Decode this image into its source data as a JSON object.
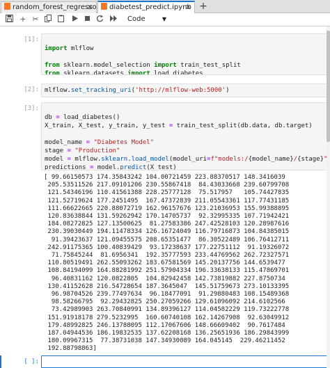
{
  "tabs": [
    {
      "label": "random_forest_regressor_s",
      "active": false
    },
    {
      "label": "diabetest_predict.ipynb",
      "active": true
    }
  ],
  "toolbar": {
    "cell_type": "Code"
  },
  "cells": [
    {
      "prompt": "[1]:",
      "lines": [
        "import mlflow",
        "",
        "from sklearn.model_selection import train_test_split",
        "from sklearn.datasets import load_diabetes"
      ]
    },
    {
      "prompt": "[2]:",
      "lines": [
        "mlflow.set_tracking_uri('http://mlflow-web:5000')"
      ]
    },
    {
      "prompt": "[3]:",
      "lines": [
        "db = load_diabetes()",
        "X_train, X_test, y_train, y_test = train_test_split(db.data, db.target)",
        "",
        "model_name = \"Diabetes Model\"",
        "stage = \"Production\"",
        "model = mlflow.sklearn.load_model(model_uri=f\"models:/{model_name}/{stage}\")",
        "predictions = model.predict(X_test)",
        "print(predictions)"
      ],
      "output": [
        "[ 99.66150573 174.35843242 104.00721459 223.88370517 148.3416039",
        " 205.53511526 217.09101206 230.55867418  84.43033668 239.60799708",
        " 121.54346196 110.41561388 228.25777128  75.517957   105.74427835",
        " 121.52719624 177.2451495  167.47372839 211.05543361 117.77431185",
        " 111.66622665 220.88072719 162.96157676 123.21036953 155.99388895",
        " 120.83638844 131.59262942 170.14705737  92.32995335 107.71942421",
        " 184.08272825 127.13500625  81.27583386 247.42528103 120.28987616",
        " 230.39030449 194.11478334 126.16724049 116.79716873 104.84385015",
        "  91.39423637 121.09455575 208.65351477  86.30522489 106.76412711",
        " 242.91175365 100.40839429  93.17238637 177.22751112  91.19326072",
        "  71.75845244  81.6956341  192.35777593 233.44769562 262.72327571",
        " 110.80519491 262.55093262 183.67581569 145.20137756 144.6539477",
        " 108.84194099 164.88281992 251.57904334 196.33638133 115.47869701",
        "  96.40831162 120.0822805  104.82942458 142.73819882 227.8750734",
        " 130.41152628 216.54728654 187.3645047  145.51759673 273.10133395",
        "  96.98704526 239.77497634  96.18477091  91.29880483 108.15489368",
        "  98.58266795  92.29432825 250.27059266 129.61096092 214.6102566",
        "  73.42989903 263.70840991 134.89396127 114.04582229 119.73222778",
        " 151.91918178 279.5232995  160.60740108 162.14267908  92.63049912",
        " 179.48992825 246.13788095 112.17067606 148.66609402  90.7617484",
        " 187.04944536 186.19832535 137.62208168 136.25651936 186.29843999",
        " 180.09967315  77.38731038 147.34930089 164.045145  229.46211452",
        " 192.88798863]"
      ]
    },
    {
      "prompt": "[ ]:",
      "lines": [
        ""
      ]
    }
  ]
}
